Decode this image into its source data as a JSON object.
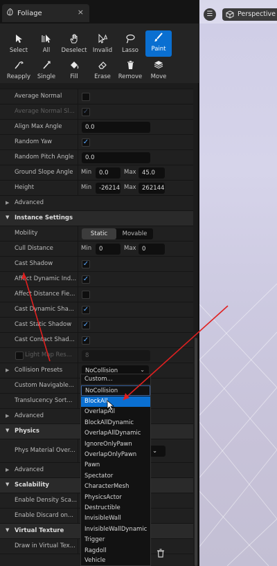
{
  "tab": {
    "title": "Foliage",
    "close": "×"
  },
  "toolbar": {
    "tools": [
      {
        "label": "Select",
        "icon": "select-arrow-icon",
        "active": false
      },
      {
        "label": "All",
        "icon": "select-all-icon",
        "active": false
      },
      {
        "label": "Deselect",
        "icon": "deselect-hand-icon",
        "active": false
      },
      {
        "label": "Invalid",
        "icon": "invalid-cursor-icon",
        "active": false
      },
      {
        "label": "Lasso",
        "icon": "lasso-icon",
        "active": false
      },
      {
        "label": "Paint",
        "icon": "paint-brush-icon",
        "active": true
      },
      {
        "label": "Reapply",
        "icon": "reapply-icon",
        "active": false
      },
      {
        "label": "Single",
        "icon": "single-instance-icon",
        "active": false
      },
      {
        "label": "Fill",
        "icon": "fill-bucket-icon",
        "active": false
      },
      {
        "label": "Erase",
        "icon": "erase-icon",
        "active": false
      },
      {
        "label": "Remove",
        "icon": "remove-icon",
        "active": false
      },
      {
        "label": "Move",
        "icon": "move-icon",
        "active": false
      }
    ]
  },
  "placement": {
    "average_normal": "Average Normal",
    "average_normal_sharp": "Average Normal Sl...",
    "align_max_angle": {
      "label": "Align Max Angle",
      "value": "0.0"
    },
    "random_yaw": "Random Yaw",
    "random_pitch_angle": {
      "label": "Random Pitch Angle",
      "value": "0.0"
    },
    "ground_slope_angle": {
      "label": "Ground Slope Angle",
      "min_label": "Min",
      "min": "0.0",
      "max_label": "Max",
      "max": "45.0"
    },
    "height": {
      "label": "Height",
      "min_label": "Min",
      "min": "-26214",
      "max_label": "Max",
      "max": "262144"
    },
    "advanced": "Advanced"
  },
  "instance": {
    "header": "Instance Settings",
    "mobility": {
      "label": "Mobility",
      "static": "Static",
      "movable": "Movable"
    },
    "cull_distance": {
      "label": "Cull Distance",
      "min_label": "Min",
      "min": "0",
      "max_label": "Max",
      "max": "0"
    },
    "cast_shadow": "Cast Shadow",
    "affect_dynamic": "Affect Dynamic Ind...",
    "affect_distance": "Affect Distance Fie...",
    "cast_dynamic_shadow": "Cast Dynamic Sha...",
    "cast_static_shadow": "Cast Static Shadow",
    "cast_contact_shadow": "Cast Contact Shad...",
    "light_map_res": {
      "label": "Light Map Res...",
      "value": "8"
    },
    "collision_presets": {
      "label": "Collision Presets",
      "value": "NoCollision",
      "arrow": "⌄"
    },
    "custom_navigable": "Custom Navigable...",
    "translucency_sort": "Translucency Sort...",
    "advanced": "Advanced"
  },
  "physics": {
    "header": "Physics",
    "phys_material": "Phys Material Over...",
    "advanced": "Advanced"
  },
  "scalability": {
    "header": "Scalability",
    "density": "Enable Density Sca...",
    "discard": "Enable Discard on..."
  },
  "virtual_texture": {
    "header": "Virtual Texture",
    "draw": "Draw in Virtual Tex..."
  },
  "dropdown": {
    "options": [
      "Custom...",
      "NoCollision",
      "BlockAll",
      "OverlapAll",
      "BlockAllDynamic",
      "OverlapAllDynamic",
      "IgnoreOnlyPawn",
      "OverlapOnlyPawn",
      "Pawn",
      "Spectator",
      "CharacterMesh",
      "PhysicsActor",
      "Destructible",
      "InvisibleWall",
      "InvisibleWallDynamic",
      "Trigger",
      "Ragdoll",
      "Vehicle"
    ],
    "highlighted": "BlockAll",
    "current": "NoCollision"
  },
  "viewport": {
    "menu": "☰",
    "mode": "Perspective"
  },
  "colors": {
    "accent": "#0a6fd1",
    "annotation": "#e02020",
    "panel": "#1c1c1c"
  }
}
